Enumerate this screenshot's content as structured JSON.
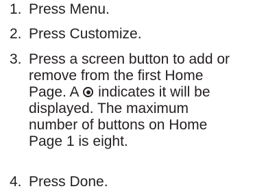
{
  "steps": [
    {
      "number": "1.",
      "lines": [
        "Press Menu."
      ]
    },
    {
      "number": "2.",
      "lines": [
        "Press Customize."
      ]
    },
    {
      "number": "3.",
      "lines": [
        "Press a screen button to add or",
        "remove from the first Home",
        "Page. A",
        "indicates it will be",
        "displayed. The maximum",
        "number of buttons on Home",
        "Page 1 is eight."
      ],
      "icon": "radio-selected-icon"
    },
    {
      "number": "4.",
      "lines": [
        "Press Done."
      ]
    }
  ]
}
